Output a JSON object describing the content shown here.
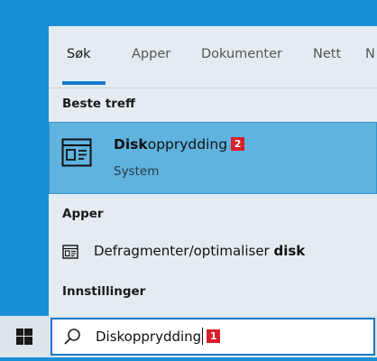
{
  "tabs": [
    {
      "label": "Søk"
    },
    {
      "label": "Apper"
    },
    {
      "label": "Dokumenter"
    },
    {
      "label": "Nett"
    },
    {
      "label": "N"
    }
  ],
  "sections": {
    "best_match": "Beste treff",
    "apps": "Apper",
    "settings": "Innstillinger"
  },
  "best_match": {
    "title_bold": "Disk",
    "title_rest": "opprydding",
    "badge": "2",
    "subtitle": "System"
  },
  "app_result": {
    "label_main": "Defragmenter/optimaliser ",
    "label_bold": "disk"
  },
  "search": {
    "value": "Diskopprydding",
    "badge": "1"
  },
  "colors": {
    "accent": "#1479c9",
    "selection": "#5fb3de",
    "badge": "#d8202a"
  }
}
